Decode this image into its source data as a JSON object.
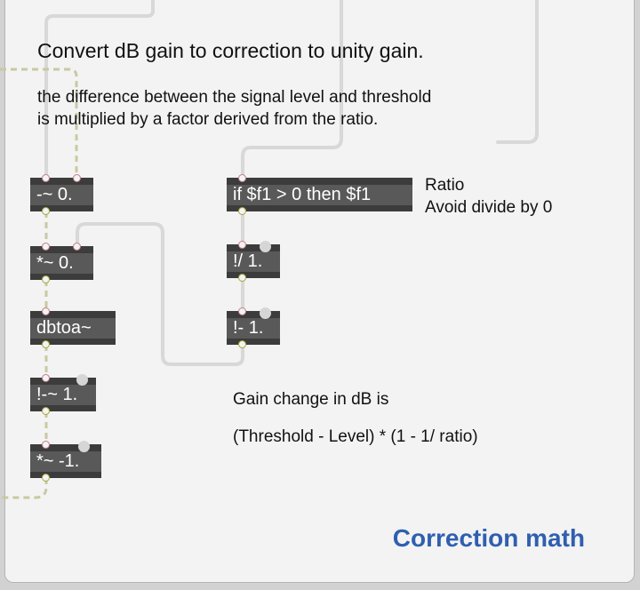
{
  "comments": {
    "heading": "Convert dB gain to correction to unity gain.",
    "desc_line1": "the difference between the signal level and threshold",
    "desc_line2": "is multiplied by a factor derived from the ratio.",
    "ratio_label": "Ratio",
    "ratio_note": "Avoid divide by 0",
    "gain_line1": "Gain change in dB is",
    "gain_line2": "(Threshold - Level) * (1 - 1/ ratio)"
  },
  "objects": {
    "minus_signal": "-~ 0.",
    "times_signal": "*~ 0.",
    "dbtoa": "dbtoa~",
    "rminus_signal": "!-~ 1.",
    "times_neg": "*~ -1.",
    "if_ratio": "if $f1 > 0 then $f1",
    "rdiv": "!/ 1.",
    "rminus": "!- 1."
  },
  "section_title": "Correction math",
  "colors": {
    "object_bg": "#595959",
    "object_text": "#ffffff",
    "signal_cable": "#c9c9a3",
    "control_cable": "#d8d8d8",
    "section_title": "#2f5fb0"
  }
}
